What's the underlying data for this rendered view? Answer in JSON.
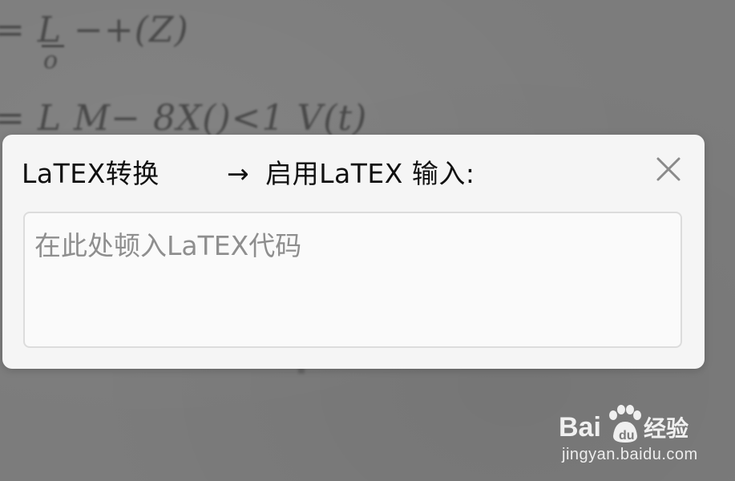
{
  "background": {
    "math_line_1": "= L −+(Z)",
    "math_line_1_denominator": "o",
    "math_line_2": "= L  M− 8X()<1 V(t)"
  },
  "dialog": {
    "title": "LaTEX转换",
    "subtitle_arrow": "→",
    "subtitle": "启用LaTEX 输入:",
    "close_icon": "close-icon",
    "input": {
      "value": "",
      "placeholder": "在此处顿入LaTEX代码"
    }
  },
  "watermark": {
    "logo_text": "Bai du 经验",
    "url": "jingyan.baidu.com"
  },
  "colors": {
    "background": "#7a7a7a",
    "dialog_bg": "#f5f5f5",
    "placeholder": "#8e8e8e",
    "title_text": "#111111"
  }
}
